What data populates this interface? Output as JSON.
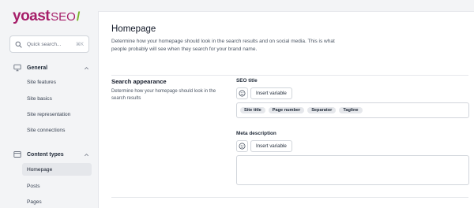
{
  "logo": {
    "main": "yoast",
    "seo": "SEO",
    "slash": "/"
  },
  "search": {
    "placeholder": "Quick search...",
    "shortcut": "⌘K"
  },
  "sidebar": {
    "groups": [
      {
        "label": "General",
        "icon": "desktop-icon",
        "items": [
          "Site features",
          "Site basics",
          "Site representation",
          "Site connections"
        ]
      },
      {
        "label": "Content types",
        "icon": "pages-icon",
        "items": [
          "Homepage",
          "Posts",
          "Pages"
        ],
        "active_item": "Homepage"
      }
    ]
  },
  "main": {
    "title": "Homepage",
    "description": "Determine how your homepage should look in the search results and on social media. This is what people probably will see when they search for your brand name.",
    "section": {
      "title": "Search appearance",
      "description": "Determine how your homepage should look in the search results"
    },
    "seo_title": {
      "label": "SEO title",
      "insert_label": "Insert variable",
      "tags": [
        "Site title",
        "Page number",
        "Separator",
        "Tagline"
      ]
    },
    "meta_description": {
      "label": "Meta description",
      "insert_label": "Insert variable",
      "value": ""
    }
  },
  "colors": {
    "brand": "#a61e69",
    "accent": "#77b227"
  }
}
